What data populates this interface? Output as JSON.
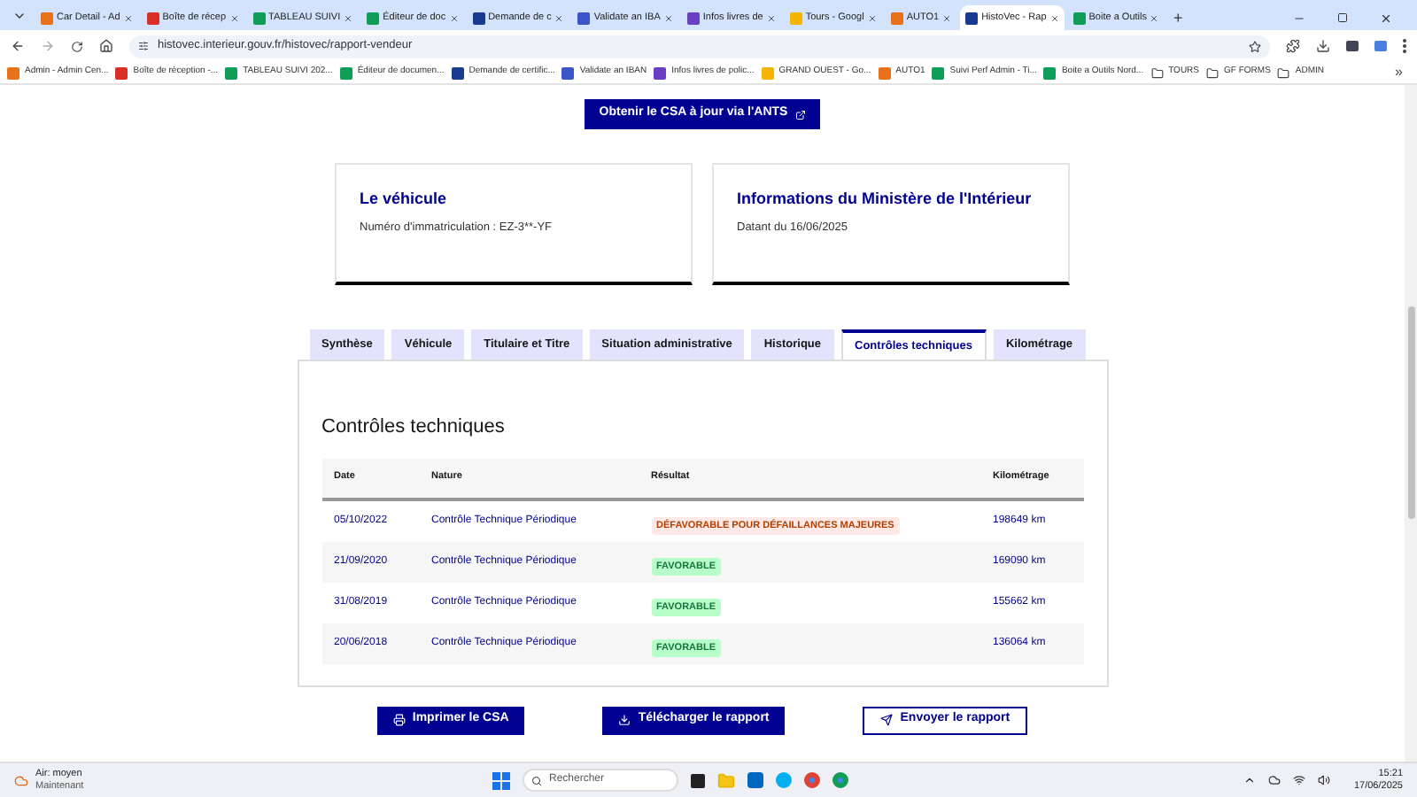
{
  "browser": {
    "tabs": [
      {
        "title": "Car Detail - Ad",
        "selected": false,
        "color": "#e8711a"
      },
      {
        "title": "Boîte de récep",
        "selected": false,
        "color": "#d93025"
      },
      {
        "title": "TABLEAU SUIVI",
        "selected": false,
        "color": "#0f9d58"
      },
      {
        "title": "Éditeur de doc",
        "selected": false,
        "color": "#0f9d58"
      },
      {
        "title": "Demande de c",
        "selected": false,
        "color": "#1a3a8f"
      },
      {
        "title": "Validate an IBA",
        "selected": false,
        "color": "#3b55c8"
      },
      {
        "title": "Infos livres de",
        "selected": false,
        "color": "#6b3fc4"
      },
      {
        "title": "Tours - Googl",
        "selected": false,
        "color": "#f4b400"
      },
      {
        "title": "AUTO1",
        "selected": false,
        "color": "#e8711a"
      },
      {
        "title": "HistoVec - Rap",
        "selected": true,
        "color": "#1a3a8f"
      },
      {
        "title": "Boite a Outils",
        "selected": false,
        "color": "#0f9d58"
      }
    ],
    "new_tab": "+",
    "url": "histovec.interieur.gouv.fr/histovec/rapport-vendeur",
    "bookmarks": [
      {
        "label": "Admin - Admin Cen...",
        "kind": "site",
        "color": "#e8711a"
      },
      {
        "label": "Boîte de réception -...",
        "kind": "site",
        "color": "#d93025"
      },
      {
        "label": "TABLEAU SUIVI 202...",
        "kind": "site",
        "color": "#0f9d58"
      },
      {
        "label": "Éditeur de documen...",
        "kind": "site",
        "color": "#0f9d58"
      },
      {
        "label": "Demande de certific...",
        "kind": "site",
        "color": "#1a3a8f"
      },
      {
        "label": "Validate an IBAN",
        "kind": "site",
        "color": "#3b55c8"
      },
      {
        "label": "Infos livres de polic...",
        "kind": "site",
        "color": "#6b3fc4"
      },
      {
        "label": "GRAND OUEST - Go...",
        "kind": "site",
        "color": "#f4b400"
      },
      {
        "label": "AUTO1",
        "kind": "site",
        "color": "#e8711a"
      },
      {
        "label": "Suivi Perf Admin - Ti...",
        "kind": "site",
        "color": "#0f9d58"
      },
      {
        "label": "Boite a Outils Nord...",
        "kind": "site",
        "color": "#0f9d58"
      },
      {
        "label": "TOURS",
        "kind": "folder"
      },
      {
        "label": "GF FORMS",
        "kind": "folder"
      },
      {
        "label": "ADMIN",
        "kind": "folder"
      }
    ],
    "bookmarks_more": "»"
  },
  "page": {
    "csa_button": "Obtenir le CSA à jour via l'ANTS",
    "cards": [
      {
        "title": "Le véhicule",
        "text": "Numéro d'immatriculation : EZ-3**-YF"
      },
      {
        "title": "Informations du Ministère de l'Intérieur",
        "text": "Datant du 16/06/2025"
      }
    ],
    "tabs": [
      {
        "label": "Synthèse",
        "selected": false
      },
      {
        "label": "Véhicule",
        "selected": false
      },
      {
        "label": "Titulaire et Titre",
        "selected": false
      },
      {
        "label": "Situation administrative",
        "selected": false
      },
      {
        "label": "Historique",
        "selected": false
      },
      {
        "label": "Contrôles techniques",
        "selected": true
      },
      {
        "label": "Kilométrage",
        "selected": false
      }
    ],
    "section_title": "Contrôles techniques",
    "table": {
      "columns": [
        "Date",
        "Nature",
        "Résultat",
        "Kilométrage"
      ],
      "rows": [
        {
          "date": "05/10/2022",
          "nature": "Contrôle Technique Périodique",
          "result": "DÉFAVORABLE POUR DÉFAILLANCES MAJEURES",
          "failed": true,
          "km": "198649 km"
        },
        {
          "date": "21/09/2020",
          "nature": "Contrôle Technique Périodique",
          "result": "FAVORABLE",
          "failed": false,
          "km": "169090 km"
        },
        {
          "date": "31/08/2019",
          "nature": "Contrôle Technique Périodique",
          "result": "FAVORABLE",
          "failed": false,
          "km": "155662 km"
        },
        {
          "date": "20/06/2018",
          "nature": "Contrôle Technique Périodique",
          "result": "FAVORABLE",
          "failed": false,
          "km": "136064 km"
        }
      ]
    },
    "actions": [
      {
        "label": "Imprimer le CSA",
        "kind": "filled"
      },
      {
        "label": "Télécharger le rapport",
        "kind": "filled"
      },
      {
        "label": "Envoyer le rapport",
        "kind": "outline"
      }
    ]
  },
  "taskbar": {
    "weather_title": "Air: moyen",
    "weather_subtitle": "Maintenant",
    "search_placeholder": "Rechercher",
    "time": "15:21",
    "date": "17/06/2025"
  }
}
